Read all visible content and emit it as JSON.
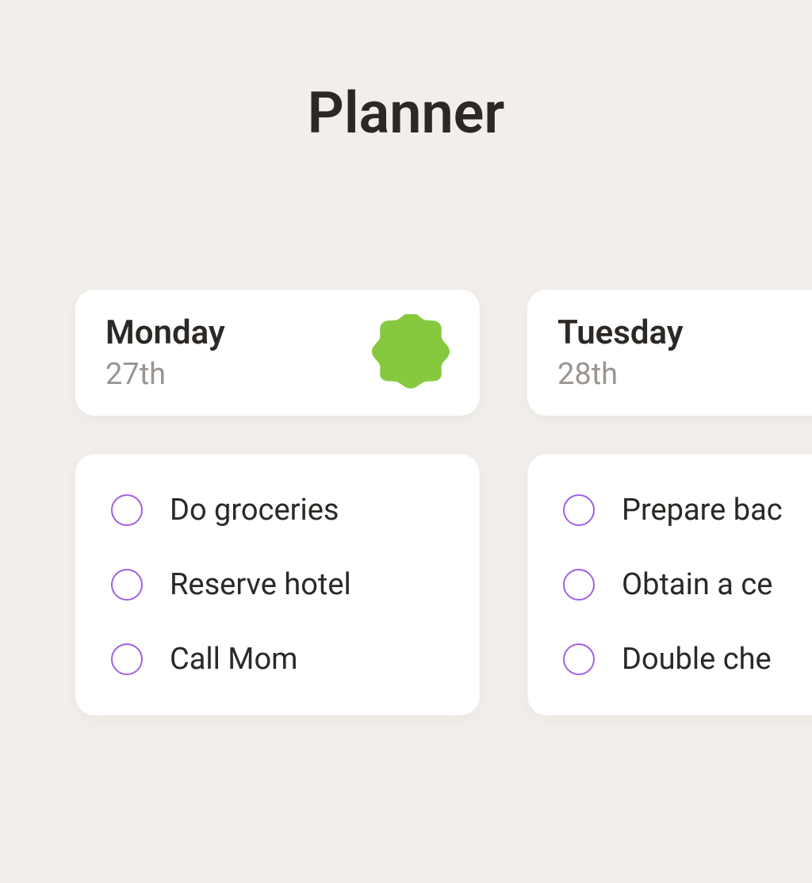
{
  "title": "Planner",
  "days": [
    {
      "name": "Monday",
      "date": "27th",
      "has_badge": true,
      "tasks": [
        {
          "label": "Do groceries"
        },
        {
          "label": "Reserve hotel"
        },
        {
          "label": "Call Mom"
        }
      ]
    },
    {
      "name": "Tuesday",
      "date": "28th",
      "has_badge": false,
      "tasks": [
        {
          "label": "Prepare bac"
        },
        {
          "label": "Obtain a ce"
        },
        {
          "label": "Double che"
        }
      ]
    }
  ],
  "colors": {
    "badge": "#86c93f",
    "checkbox_border": "#a060e8",
    "background": "#f2eeea"
  }
}
